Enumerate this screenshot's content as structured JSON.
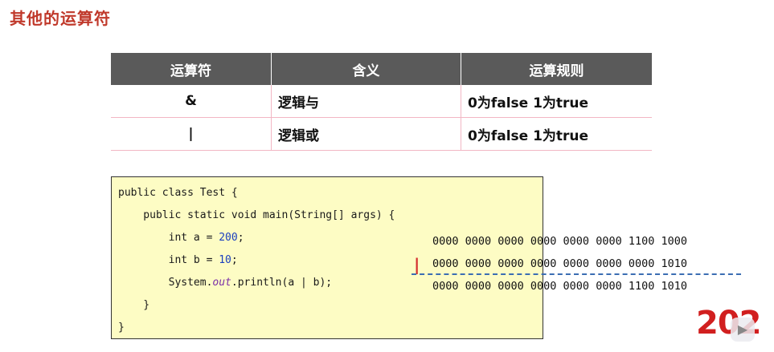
{
  "slide_title": "其他的运算符",
  "table": {
    "headers": [
      "运算符",
      "含义",
      "运算规则"
    ],
    "rows": [
      [
        "&",
        "逻辑与",
        "0为false 1为true"
      ],
      [
        "|",
        "逻辑或",
        "0为false 1为true"
      ]
    ]
  },
  "code": {
    "line1": "public class Test {",
    "line2": "    public static void main(String[] args) {",
    "line3_pre": "        int a = ",
    "line3_num": "200",
    "line3_post": ";",
    "line4_pre": "        int b = ",
    "line4_num": "10",
    "line4_post": ";",
    "line5_pre": "        System.",
    "line5_field": "out",
    "line5_post": ".println(a | b);",
    "line6": "    }",
    "line7": "}"
  },
  "binary": {
    "operator": "|",
    "a_bits": "0000 0000 0000 0000 0000 0000 1100 1000",
    "b_bits": "0000 0000 0000 0000 0000 0000 0000 1010",
    "result_bits": "0000 0000 0000 0000 0000 0000 1100 1010"
  },
  "result_value": "202",
  "overlay": {
    "icon": "play-icon",
    "glyph": "▶"
  },
  "colors": {
    "title": "#c0392b",
    "header_bg": "#5a5a5a",
    "code_bg": "#fdfcc4",
    "result": "#d11f1f",
    "dash": "#3b6db3"
  }
}
